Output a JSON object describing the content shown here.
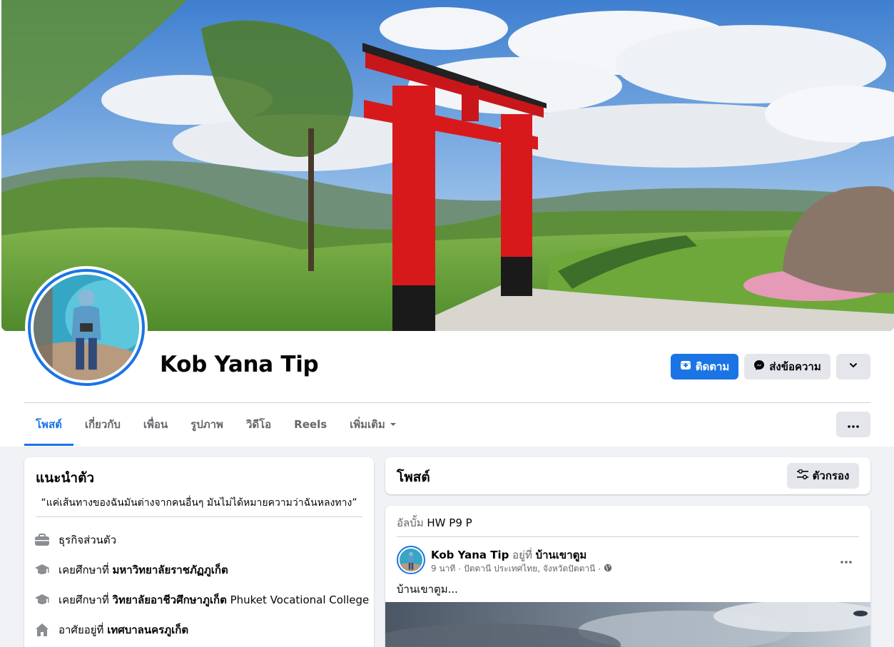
{
  "profile": {
    "name": "Kob Yana Tip",
    "follow_label": "ติดตาม",
    "message_label": "ส่งข้อความ"
  },
  "tabs": [
    {
      "label": "โพสต์",
      "active": true
    },
    {
      "label": "เกี่ยวกับ"
    },
    {
      "label": "เพื่อน"
    },
    {
      "label": "รูปภาพ"
    },
    {
      "label": "วิดีโอ"
    },
    {
      "label": "Reels"
    },
    {
      "label": "เพิ่มเติม"
    }
  ],
  "intro": {
    "title": "แนะนำตัว",
    "bio": "“แค่เส้นทางของฉันมันต่างจากคนอื่นๆ มันไม่ได้หมายความว่าฉันหลงทาง”",
    "items": [
      {
        "icon": "briefcase-icon",
        "prefix": "ธุรกิจส่วนตัว",
        "value": ""
      },
      {
        "icon": "graduation-cap-icon",
        "prefix": "เคยศึกษาที่ ",
        "value": "มหาวิทยาลัยราชภัฏภูเก็ต"
      },
      {
        "icon": "graduation-cap-icon",
        "prefix": "เคยศึกษาที่ ",
        "value": "วิทยาลัยอาชีวศึกษาภูเก็ต",
        "suffix": " Phuket Vocational College"
      },
      {
        "icon": "home-icon",
        "prefix": "อาศัยอยู่ที่ ",
        "value": "เทศบาลนครภูเก็ต"
      }
    ]
  },
  "posts_header": {
    "title": "โพสต์",
    "filter_label": "ตัวกรอง"
  },
  "post": {
    "album_prefix": "อัลบั้ม ",
    "album_name": "HW P9 P",
    "author": "Kob Yana Tip",
    "verb": " อยู่ที่ ",
    "place": "บ้านเขาตูม",
    "time": "9 นาที",
    "location": "ปัตตานี ประเทศไทย, จังหวัดปัตตานี",
    "privacy_icon": "globe-icon",
    "text": "บ้านเขาตูม..."
  },
  "colors": {
    "accent": "#1b74e4",
    "page_bg": "#f0f2f5",
    "button_grey": "#e4e6eb",
    "secondary_text": "#65676b"
  }
}
